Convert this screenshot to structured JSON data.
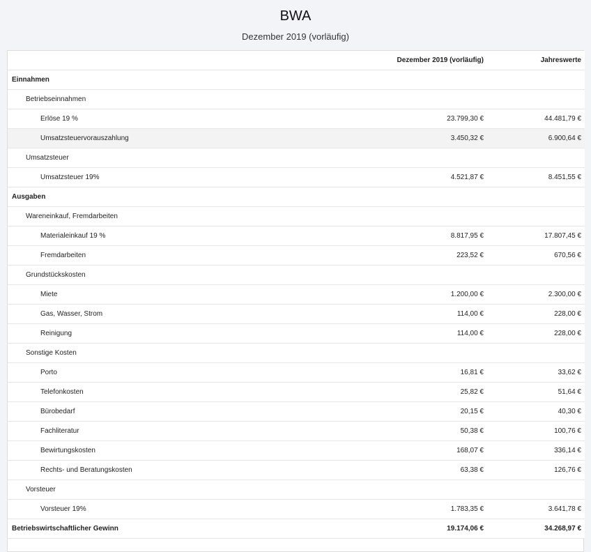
{
  "report": {
    "title": "BWA",
    "subtitle": "Dezember 2019 (vorläufig)"
  },
  "table": {
    "headers": [
      "",
      "Dezember 2019 (vorläufig)",
      "Jahreswerte"
    ],
    "rows": [
      {
        "type": "section",
        "level": 0,
        "label": "Einnahmen",
        "month": "",
        "year": ""
      },
      {
        "type": "group",
        "level": 1,
        "label": "Betriebseinnahmen",
        "month": "",
        "year": ""
      },
      {
        "type": "item",
        "level": 2,
        "label": "Erlöse 19 %",
        "month": "23.799,30 €",
        "year": "44.481,79 €"
      },
      {
        "type": "item",
        "level": 2,
        "label": "Umsatzsteuervorauszahlung",
        "month": "3.450,32 €",
        "year": "6.900,64 €",
        "shade": true
      },
      {
        "type": "group",
        "level": 1,
        "label": "Umsatzsteuer",
        "month": "",
        "year": ""
      },
      {
        "type": "item",
        "level": 2,
        "label": "Umsatzsteuer 19%",
        "month": "4.521,87 €",
        "year": "8.451,55 €"
      },
      {
        "type": "section",
        "level": 0,
        "label": "Ausgaben",
        "month": "",
        "year": ""
      },
      {
        "type": "group",
        "level": 1,
        "label": "Wareneinkauf, Fremdarbeiten",
        "month": "",
        "year": ""
      },
      {
        "type": "item",
        "level": 2,
        "label": "Materialeinkauf 19 %",
        "month": "8.817,95 €",
        "year": "17.807,45 €"
      },
      {
        "type": "item",
        "level": 2,
        "label": "Fremdarbeiten",
        "month": "223,52 €",
        "year": "670,56 €"
      },
      {
        "type": "group",
        "level": 1,
        "label": "Grundstückskosten",
        "month": "",
        "year": ""
      },
      {
        "type": "item",
        "level": 2,
        "label": "Miete",
        "month": "1.200,00 €",
        "year": "2.300,00 €"
      },
      {
        "type": "item",
        "level": 2,
        "label": "Gas, Wasser, Strom",
        "month": "114,00 €",
        "year": "228,00 €"
      },
      {
        "type": "item",
        "level": 2,
        "label": "Reinigung",
        "month": "114,00 €",
        "year": "228,00 €"
      },
      {
        "type": "group",
        "level": 1,
        "label": "Sonstige Kosten",
        "month": "",
        "year": ""
      },
      {
        "type": "item",
        "level": 2,
        "label": "Porto",
        "month": "16,81 €",
        "year": "33,62 €"
      },
      {
        "type": "item",
        "level": 2,
        "label": "Telefonkosten",
        "month": "25,82 €",
        "year": "51,64 €"
      },
      {
        "type": "item",
        "level": 2,
        "label": "Bürobedarf",
        "month": "20,15 €",
        "year": "40,30 €"
      },
      {
        "type": "item",
        "level": 2,
        "label": "Fachliteratur",
        "month": "50,38 €",
        "year": "100,76 €"
      },
      {
        "type": "item",
        "level": 2,
        "label": "Bewirtungskosten",
        "month": "168,07 €",
        "year": "336,14 €"
      },
      {
        "type": "item",
        "level": 2,
        "label": "Rechts- und Beratungskosten",
        "month": "63,38 €",
        "year": "126,76 €"
      },
      {
        "type": "group",
        "level": 1,
        "label": "Vorsteuer",
        "month": "",
        "year": ""
      },
      {
        "type": "item",
        "level": 2,
        "label": "Vorsteuer 19%",
        "month": "1.783,35 €",
        "year": "3.641,78 €"
      },
      {
        "type": "total",
        "level": 0,
        "label": "Betriebswirtschaftlicher Gewinn",
        "month": "19.174,06 €",
        "year": "34.268,97 €"
      }
    ]
  }
}
